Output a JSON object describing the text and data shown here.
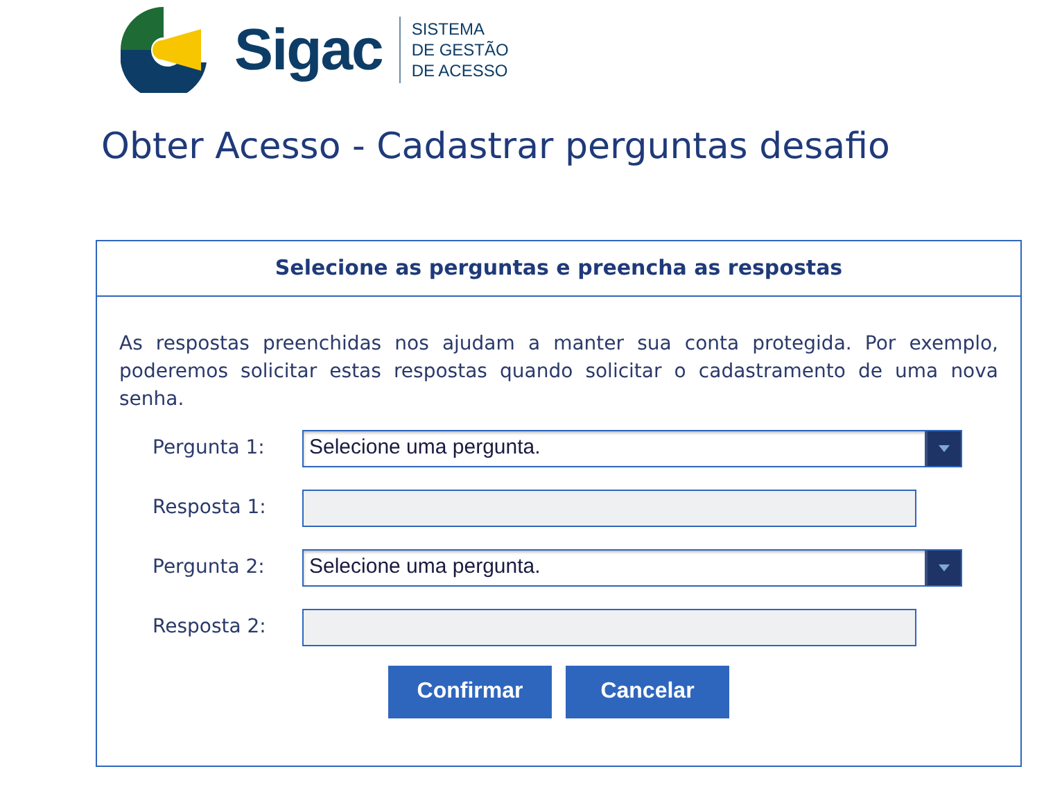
{
  "logo": {
    "name": "Sigac",
    "tagline": [
      "SISTEMA",
      "DE GESTÃO",
      "DE ACESSO"
    ]
  },
  "page_title": "Obter Acesso - Cadastrar perguntas desafio",
  "panel": {
    "heading": "Selecione as perguntas e preencha as respostas",
    "intro": "As respostas preenchidas nos ajudam a manter sua conta protegida. Por exemplo, poderemos solicitar estas respostas quando solicitar o cadastramento de uma nova senha.",
    "fields": [
      {
        "kind": "select",
        "label": "Pergunta 1:",
        "value": "Selecione uma pergunta."
      },
      {
        "kind": "text",
        "label": "Resposta 1:",
        "disabled": true
      },
      {
        "kind": "select",
        "label": "Pergunta 2:",
        "value": "Selecione uma pergunta."
      },
      {
        "kind": "text",
        "label": "Resposta 2:",
        "disabled": true
      }
    ],
    "buttons": [
      "Confirmar",
      "Cancelar"
    ]
  }
}
